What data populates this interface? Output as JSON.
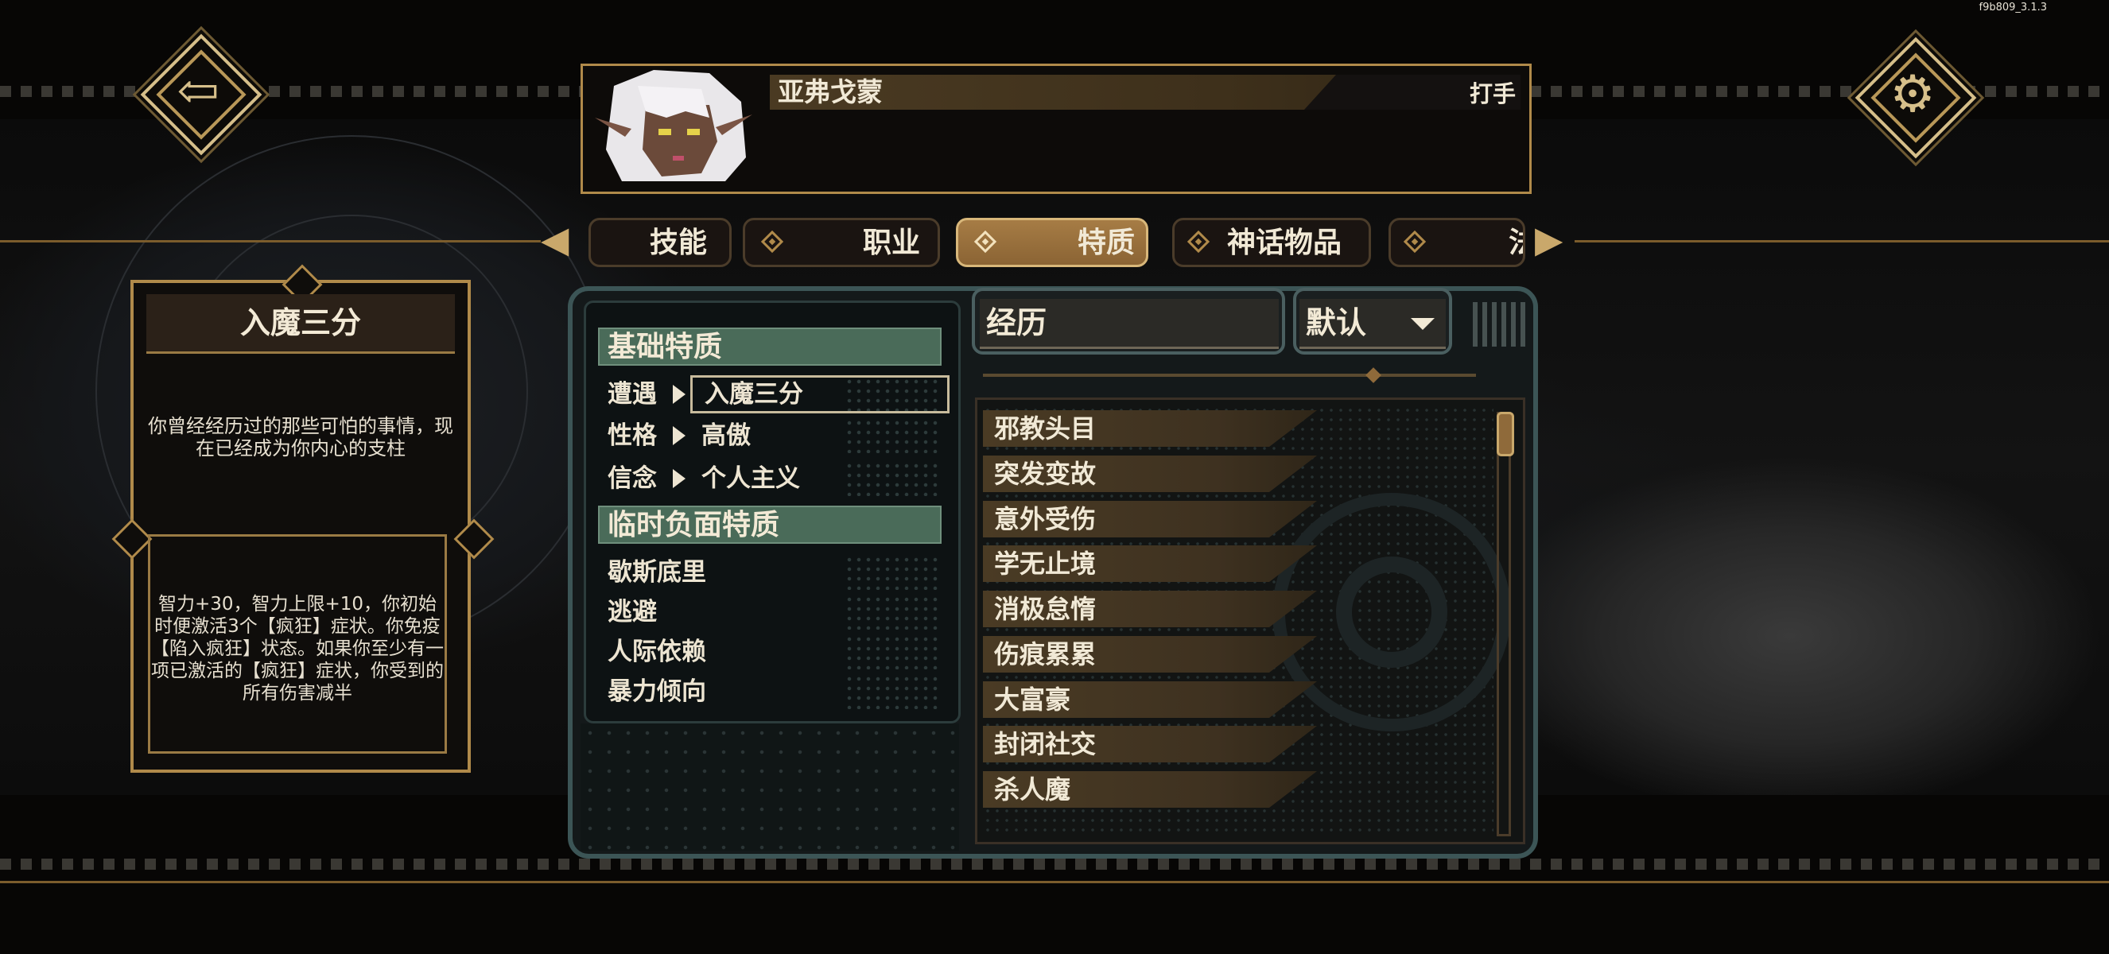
{
  "version": "f9b809_3.1.3",
  "nav": {
    "back_icon": "back-arrow-icon",
    "settings_icon": "gear-icon"
  },
  "character": {
    "name": "亚弗戈蒙",
    "job": "打手"
  },
  "tabs": [
    {
      "label": "技能",
      "active": false
    },
    {
      "label": "职业",
      "active": false
    },
    {
      "label": "特质",
      "active": true
    },
    {
      "label": "神话物品",
      "active": false
    },
    {
      "label": "法",
      "active": false
    }
  ],
  "detail_card": {
    "title": "入魔三分",
    "flavor": "你曾经经历过的那些可怕的事情，现在已经成为你内心的支柱",
    "effect": "智力+30，智力上限+10，你初始时便激活3个【疯狂】症状。你免疫【陷入疯狂】状态。如果你至少有一项已激活的【疯狂】症状，你受到的所有伤害减半"
  },
  "basic_traits": {
    "header": "基础特质",
    "rows": [
      {
        "label": "遭遇",
        "value": "入魔三分"
      },
      {
        "label": "性格",
        "value": "高傲"
      },
      {
        "label": "信念",
        "value": "个人主义"
      }
    ]
  },
  "temp_negative_traits": {
    "header": "临时负面特质",
    "items": [
      "歇斯底里",
      "逃避",
      "人际依赖",
      "暴力倾向"
    ]
  },
  "search": {
    "value": "经历"
  },
  "sort": {
    "value": "默认"
  },
  "trait_list": [
    "邪教头目",
    "突发变故",
    "意外受伤",
    "学无止境",
    "消极怠惰",
    "伤痕累累",
    "大富豪",
    "封闭社交",
    "杀人魔"
  ],
  "colors": {
    "gold": "#b08a4a",
    "teal_frame": "#3c5556",
    "green_header": "#4a6b59",
    "active_tab": "#a67c45"
  }
}
